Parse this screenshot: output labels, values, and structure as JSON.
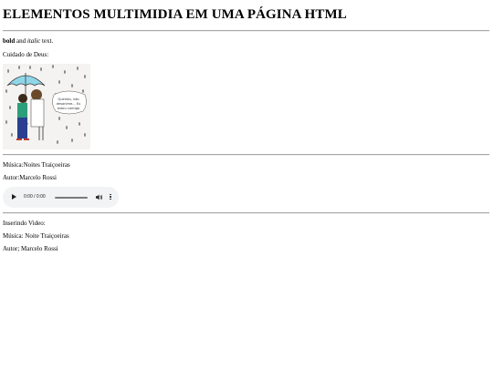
{
  "page": {
    "heading": "ELEMENTOS MULTIMIDIA EM UMA PÁGINA HTML",
    "bold_word": "bold",
    "and_word": " and ",
    "italic_word": "italic",
    "text_word": " text.",
    "caption_image": "Cuidado de Deus:",
    "image_bubble_text": "Querido, não desanime... Eu estou contigo",
    "music_label": "Música:",
    "music_title": "Noites Traiçoeiras",
    "author_label": "Autor:",
    "author_name": "Marcelo Rossi",
    "audio_time": "0:00 / 0:00",
    "video_label": "Inserindo Video:",
    "video_music": "Música: Noite Traiçoeiras",
    "video_author": "Autor; Marcelo Rossi"
  },
  "icons": {
    "play": "play-icon",
    "volume": "volume-icon",
    "more": "more-options-icon"
  },
  "colors": {
    "divider": "#a8a8a8",
    "audio_bg": "#f1f3f4",
    "umbrella": "#8fd6e8",
    "shirt_green": "#2c9e7a",
    "pants_blue": "#2a3f8f"
  }
}
